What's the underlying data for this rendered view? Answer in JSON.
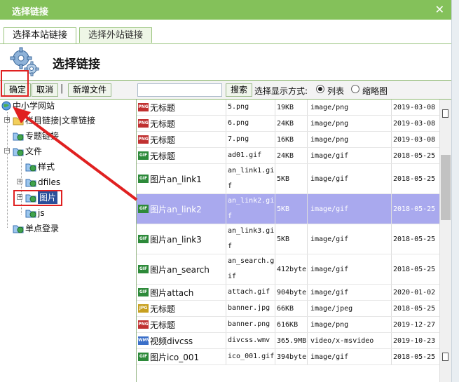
{
  "window": {
    "title": "选择链接",
    "close_glyph": "✕"
  },
  "tabs": [
    {
      "label": "选择本站链接",
      "active": true
    },
    {
      "label": "选择外站链接",
      "active": false
    }
  ],
  "header": {
    "title": "选择链接",
    "icon": "gears-icon"
  },
  "toolbar": {
    "confirm": "确定",
    "cancel": "取消",
    "separator": "|",
    "new_file": "新增文件",
    "search_value": "",
    "search_button": "搜索",
    "display_mode_label": "选择显示方式:",
    "mode_list": "列表",
    "mode_thumb": "缩略图",
    "selected_mode": "list"
  },
  "tree": [
    {
      "label": "中小学网站",
      "icon": "globe-icon"
    },
    {
      "label": "栏目链接|文章链接",
      "icon": "folder-icon"
    },
    {
      "label": "专题链接",
      "icon": "folder-globe-icon"
    },
    {
      "label": "文件",
      "icon": "folder-globe-icon"
    },
    {
      "label": "样式",
      "icon": "folder-globe-icon"
    },
    {
      "label": "dfiles",
      "icon": "folder-globe-icon"
    },
    {
      "label": "图片",
      "icon": "folder-globe-icon",
      "selected": true
    },
    {
      "label": "js",
      "icon": "folder-globe-icon"
    },
    {
      "label": "单点登录",
      "icon": "folder-globe-icon"
    }
  ],
  "files": [
    {
      "ext": "PNG",
      "name": "无标题",
      "file": "5.png",
      "size": "19KB",
      "type": "image/png",
      "date": "2019-03-08"
    },
    {
      "ext": "PNG",
      "name": "无标题",
      "file": "6.png",
      "size": "24KB",
      "type": "image/png",
      "date": "2019-03-08"
    },
    {
      "ext": "PNG",
      "name": "无标题",
      "file": "7.png",
      "size": "16KB",
      "type": "image/png",
      "date": "2019-03-08"
    },
    {
      "ext": "GIF",
      "name": "无标题",
      "file": "ad01.gif",
      "size": "24KB",
      "type": "image/gif",
      "date": "2018-05-25"
    },
    {
      "ext": "GIF",
      "name": "图片an_link1",
      "file": "an_link1.gif",
      "size": "5KB",
      "type": "image/gif",
      "date": "2018-05-25"
    },
    {
      "ext": "GIF",
      "name": "图片an_link2",
      "file": "an_link2.gif",
      "size": "5KB",
      "type": "image/gif",
      "date": "2018-05-25",
      "selected": true
    },
    {
      "ext": "GIF",
      "name": "图片an_link3",
      "file": "an_link3.gif",
      "size": "5KB",
      "type": "image/gif",
      "date": "2018-05-25"
    },
    {
      "ext": "GIF",
      "name": "图片an_search",
      "file": "an_search.gif",
      "size": "412byte",
      "type": "image/gif",
      "date": "2018-05-25"
    },
    {
      "ext": "GIF",
      "name": "图片attach",
      "file": "attach.gif",
      "size": "904byte",
      "type": "image/gif",
      "date": "2020-01-02"
    },
    {
      "ext": "JPG",
      "name": "无标题",
      "file": "banner.jpg",
      "size": "66KB",
      "type": "image/jpeg",
      "date": "2018-05-25"
    },
    {
      "ext": "PNG",
      "name": "无标题",
      "file": "banner.png",
      "size": "616KB",
      "type": "image/png",
      "date": "2019-12-27"
    },
    {
      "ext": "WMV",
      "name": "视频divcss",
      "file": "divcss.wmv",
      "size": "365.9MB",
      "type": "video/x-msvideo",
      "date": "2019-10-23"
    },
    {
      "ext": "GIF",
      "name": "图片ico_001",
      "file": "ico_001.gif",
      "size": "394byte",
      "type": "image/gif",
      "date": "2018-05-25"
    }
  ],
  "colors": {
    "titlebar": "#84c15a",
    "selected_row": "#a9a9ee",
    "highlight_box": "#e02020",
    "png_icon": "#c03030",
    "gif_icon": "#2d8a3a",
    "jpg_icon": "#c8a020"
  }
}
